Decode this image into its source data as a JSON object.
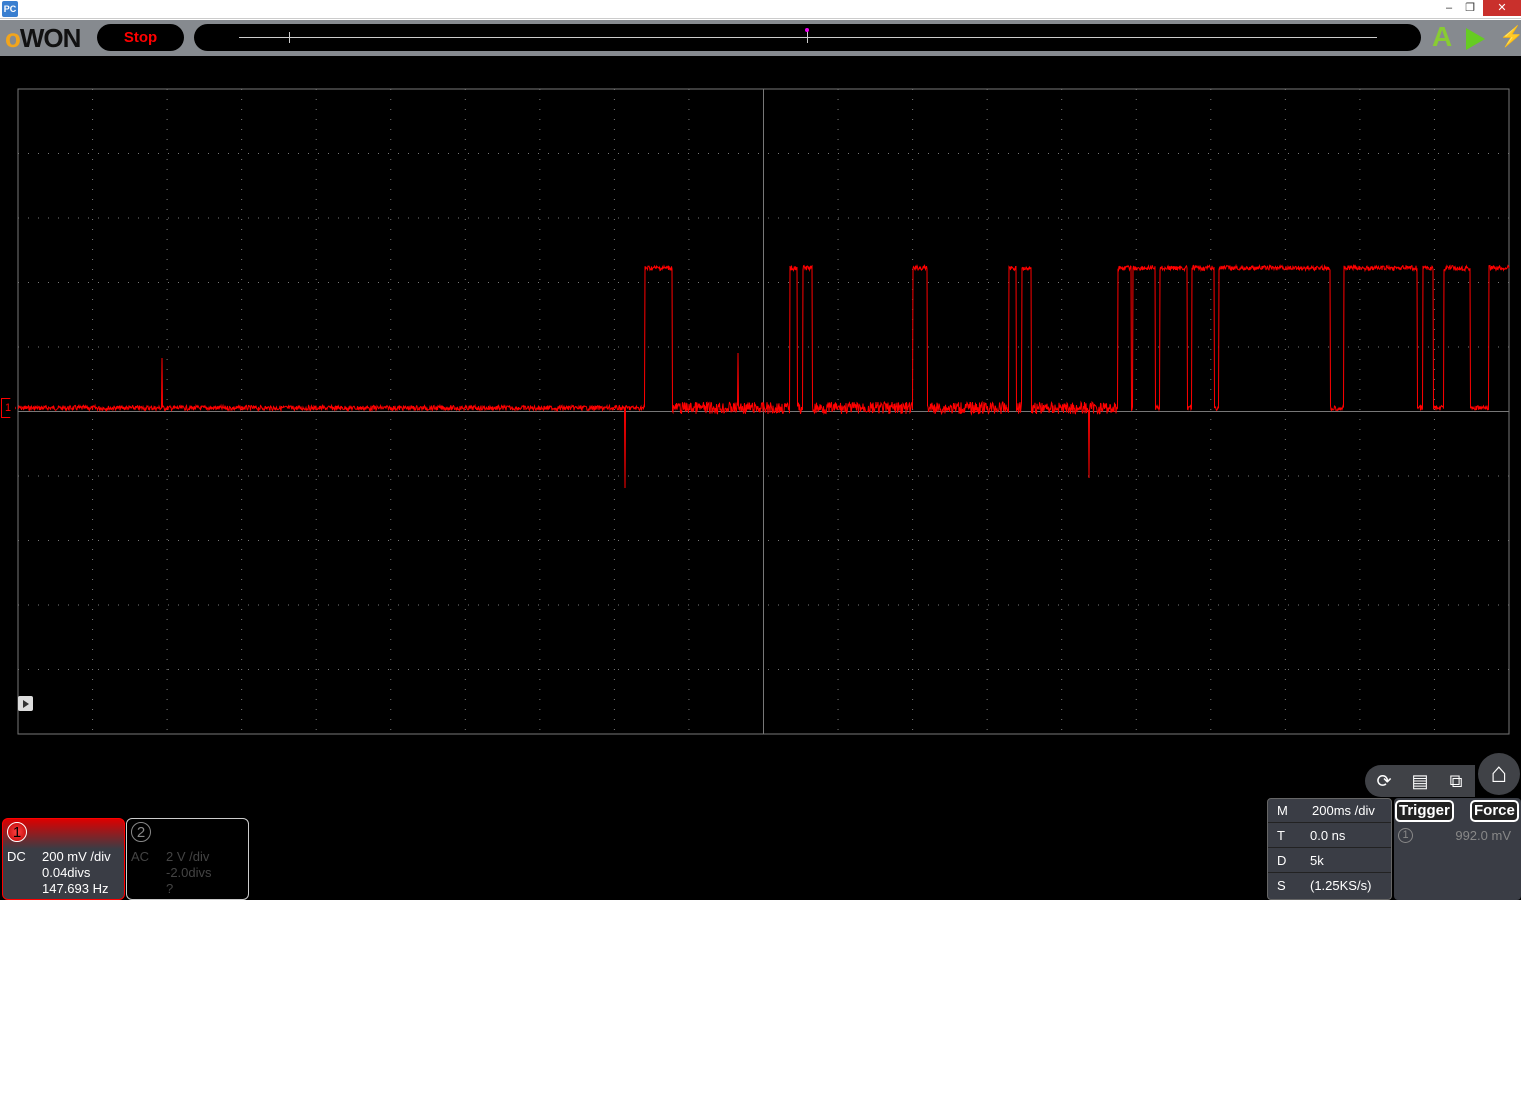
{
  "window": {
    "app_icon": "PC",
    "minimize": "–",
    "restore": "❐",
    "close": "✕"
  },
  "toolbar": {
    "logo": "OWON",
    "stop_label": "Stop",
    "auto_icon": "A",
    "run_icon": "play-icon",
    "force_icon": "bolt-icon"
  },
  "scope": {
    "ch1_marker": "1",
    "trace_color": "#ff0000",
    "grid_color": "#777777"
  },
  "channels": [
    {
      "num": "1",
      "coupling": "DC",
      "scale": "200 mV /div",
      "offset": "0.04divs",
      "freq": "147.693 Hz",
      "active": true,
      "color": "#ff0000"
    },
    {
      "num": "2",
      "coupling": "AC",
      "scale": "2 V /div",
      "offset": "-2.0divs",
      "freq": "?",
      "active": false
    }
  ],
  "tools": {
    "autoset_icon": "auto-home-icon",
    "save_icon": "save-icon",
    "switch_icon": "switch-window-icon",
    "home_icon": "home-icon"
  },
  "timebase": [
    {
      "key": "M",
      "value": "200ms /div"
    },
    {
      "key": "T",
      "value": "0.0 ns"
    },
    {
      "key": "D",
      "value": "5k"
    },
    {
      "key": "S",
      "value": "(1.25KS/s)"
    }
  ],
  "trigger": {
    "trigger_label": "Trigger",
    "force_label": "Force",
    "source": "1",
    "level": "992.0 mV"
  }
}
